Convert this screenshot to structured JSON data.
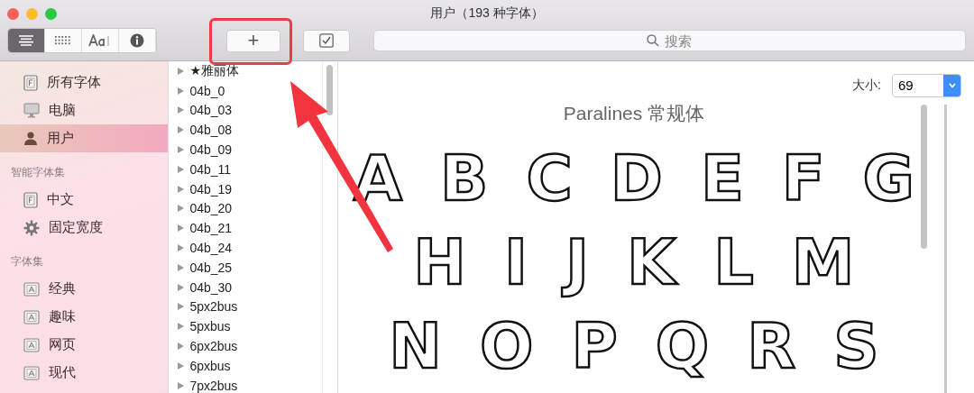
{
  "window": {
    "title": "用户（193 种字体）"
  },
  "toolbar": {
    "view_modes": [
      {
        "kind": "list",
        "selected": true
      },
      {
        "kind": "grid",
        "selected": false
      },
      {
        "kind": "sample",
        "selected": false
      },
      {
        "kind": "info",
        "selected": false
      }
    ],
    "add_button": "+",
    "search": {
      "placeholder": "搜索"
    }
  },
  "sidebar": {
    "sections": [
      {
        "items": [
          {
            "label": "所有字体",
            "kind": "font",
            "selected": false
          },
          {
            "label": "电脑",
            "kind": "computer",
            "selected": false
          },
          {
            "label": "用户",
            "kind": "user",
            "selected": true
          }
        ]
      },
      {
        "heading": "智能字体集",
        "items": [
          {
            "label": "中文",
            "kind": "font",
            "selected": false
          },
          {
            "label": "固定宽度",
            "kind": "smart",
            "selected": false
          }
        ]
      },
      {
        "heading": "字体集",
        "items": [
          {
            "label": "经典",
            "kind": "collection",
            "selected": false
          },
          {
            "label": "趣味",
            "kind": "collection",
            "selected": false
          },
          {
            "label": "网页",
            "kind": "collection",
            "selected": false
          },
          {
            "label": "现代",
            "kind": "collection",
            "selected": false
          }
        ]
      }
    ]
  },
  "font_list": [
    {
      "name": "★雅丽体",
      "expanded": false
    },
    {
      "name": "04b_0",
      "expanded": false
    },
    {
      "name": "04b_03",
      "expanded": false
    },
    {
      "name": "04b_08",
      "expanded": false
    },
    {
      "name": "04b_09",
      "expanded": false
    },
    {
      "name": "04b_11",
      "expanded": false
    },
    {
      "name": "04b_19",
      "expanded": false
    },
    {
      "name": "04b_20",
      "expanded": false
    },
    {
      "name": "04b_21",
      "expanded": false
    },
    {
      "name": "04b_24",
      "expanded": false
    },
    {
      "name": "04b_25",
      "expanded": false
    },
    {
      "name": "04b_30",
      "expanded": false
    },
    {
      "name": "5px2bus",
      "expanded": false
    },
    {
      "name": "5pxbus",
      "expanded": false
    },
    {
      "name": "6px2bus",
      "expanded": false
    },
    {
      "name": "6pxbus",
      "expanded": false
    },
    {
      "name": "7px2bus",
      "expanded": false
    }
  ],
  "preview": {
    "size_label": "大小:",
    "size": "69",
    "font_title": "Paralines 常规体",
    "rows": [
      [
        "A",
        "B",
        "C",
        "D",
        "E",
        "F",
        "G"
      ],
      [
        "H",
        "I",
        "J",
        "K",
        "L",
        "M"
      ],
      [
        "N",
        "O",
        "P",
        "Q",
        "R",
        "S"
      ]
    ]
  }
}
